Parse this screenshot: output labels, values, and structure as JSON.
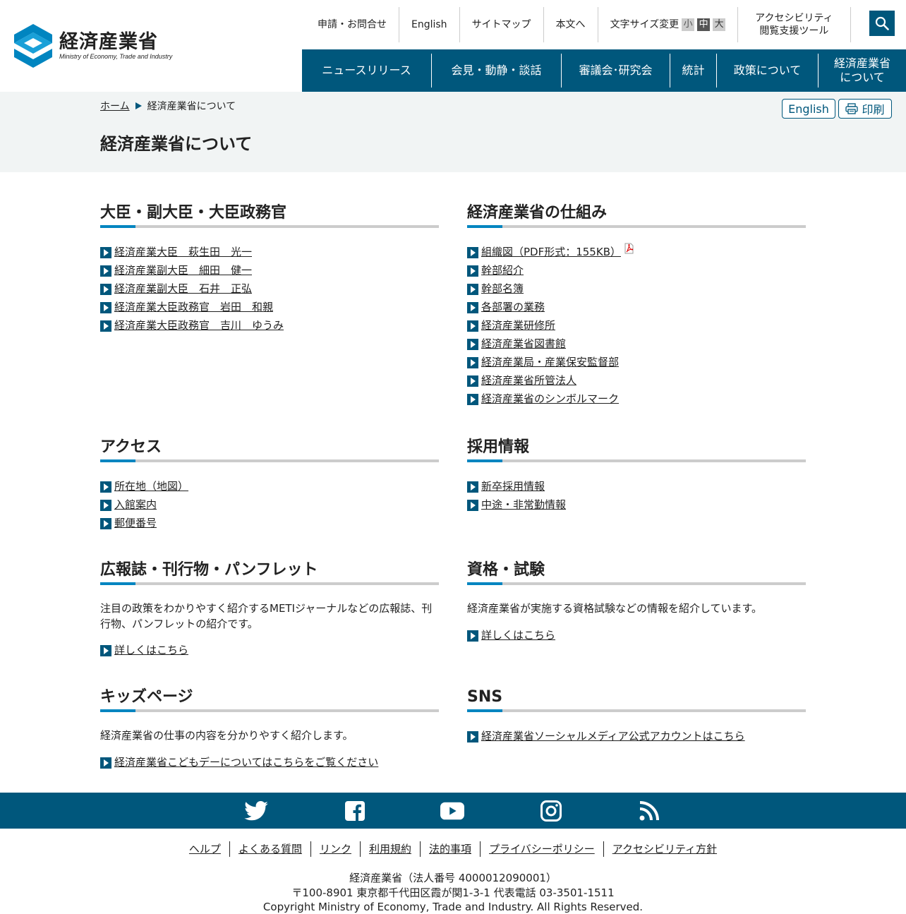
{
  "header": {
    "logo_ja": "経済産業省",
    "logo_en": "Ministry of Economy, Trade and Industry",
    "util": {
      "contact": "申請・お問合せ",
      "english": "English",
      "sitemap": "サイトマップ",
      "skip": "本文へ",
      "fontsize_label": "文字サイズ変更",
      "fs_small": "小",
      "fs_mid": "中",
      "fs_large": "大",
      "accessibility_l1": "アクセシビリティ",
      "accessibility_l2": "閲覧支援ツール"
    },
    "gnav": {
      "news": "ニュースリリース",
      "press": "会見・動静・談話",
      "council": "審議会･研究会",
      "stats": "統計",
      "policy": "政策について",
      "about_l1": "経済産業省",
      "about_l2": "について"
    }
  },
  "titleband": {
    "breadcrumb_home": "ホーム",
    "breadcrumb_current": "経済産業省について",
    "title": "経済産業省について",
    "english_button": "English",
    "print_button": "印刷"
  },
  "sections": {
    "ministers": {
      "title": "大臣・副大臣・大臣政務官",
      "links": [
        "経済産業大臣　萩生田　光一",
        "経済産業副大臣　細田　健一",
        "経済産業副大臣　石井　正弘",
        "経済産業大臣政務官　岩田　和親",
        "経済産業大臣政務官　吉川　ゆうみ"
      ]
    },
    "structure": {
      "title": "経済産業省の仕組み",
      "links": [
        "組織図（PDF形式：155KB）",
        "幹部紹介",
        "幹部名簿",
        "各部署の業務",
        "経済産業研修所",
        "経済産業省図書館",
        "経済産業局・産業保安監督部",
        "経済産業省所管法人",
        "経済産業省のシンボルマーク"
      ]
    },
    "access": {
      "title": "アクセス",
      "links": [
        "所在地（地図）",
        "入館案内",
        "郵便番号"
      ]
    },
    "recruit": {
      "title": "採用情報",
      "links": [
        "新卒採用情報",
        "中途・非常勤情報"
      ]
    },
    "publications": {
      "title": "広報誌・刊行物・パンフレット",
      "desc": "注目の政策をわかりやすく紹介するMETIジャーナルなどの広報誌、刊行物、パンフレットの紹介です。",
      "link": "詳しくはこちら"
    },
    "exams": {
      "title": "資格・試験",
      "desc": "経済産業省が実施する資格試験などの情報を紹介しています。",
      "link": "詳しくはこちら"
    },
    "kids": {
      "title": "キッズページ",
      "desc": "経済産業省の仕事の内容を分かりやすく紹介します。",
      "link": "経済産業省こどもデーについてはこちらをご覧ください"
    },
    "sns": {
      "title": "SNS",
      "link": "経済産業省ソーシャルメディア公式アカウントはこちら"
    }
  },
  "footer": {
    "links": [
      "ヘルプ",
      "よくある質問",
      "リンク",
      "利用規約",
      "法的事項",
      "プライバシーポリシー",
      "アクセシビリティ方針"
    ],
    "info_l1": "経済産業省（法人番号 4000012090001）",
    "info_l2": "〒100-8901 東京都千代田区霞が関1-3-1 代表電話 03-3501-1511",
    "info_l3": "Copyright Ministry of Economy, Trade and Industry. All Rights Reserved."
  },
  "colors": {
    "primary": "#00577c",
    "accent": "#0085c0",
    "band": "#f1f4f4"
  }
}
